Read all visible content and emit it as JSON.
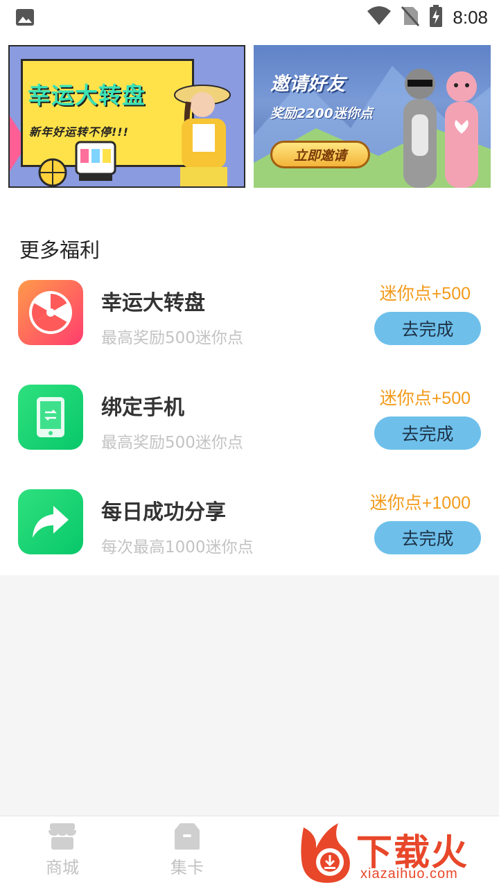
{
  "status_bar": {
    "time": "8:08",
    "icons": [
      "image-icon",
      "wifi-icon",
      "no-sim-icon",
      "battery-charging-icon"
    ]
  },
  "banners": [
    {
      "title": "幸运大转盘",
      "subtitle": "新年好运转不停!!!",
      "colors": {
        "bg": "#8b9be0",
        "panel": "#ffe24a",
        "title": "#3be2b6"
      }
    },
    {
      "title": "邀请好友",
      "subtitle": "奖励2200迷你点",
      "button_label": "立即邀请",
      "colors": {
        "bg": "#5f83c8",
        "button": "#f3b43a"
      }
    }
  ],
  "section_title": "更多福利",
  "tasks": [
    {
      "name": "幸运大转盘",
      "desc": "最高奖励500迷你点",
      "reward": "迷你点+500",
      "button_label": "去完成",
      "icon": "lucky-wheel-icon",
      "icon_colors": [
        "#ff9a4a",
        "#ff3d6e"
      ]
    },
    {
      "name": "绑定手机",
      "desc": "最高奖励500迷你点",
      "reward": "迷你点+500",
      "button_label": "去完成",
      "icon": "phone-bind-icon",
      "icon_colors": [
        "#2fe07e",
        "#08c86a"
      ]
    },
    {
      "name": "每日成功分享",
      "desc": "每次最高1000迷你点",
      "reward": "迷你点+1000",
      "button_label": "去完成",
      "icon": "share-icon",
      "icon_colors": [
        "#2fe07e",
        "#08c86a"
      ]
    }
  ],
  "bottom_nav": [
    {
      "label": "商城",
      "icon": "store-icon"
    },
    {
      "label": "集卡",
      "icon": "card-box-icon"
    }
  ],
  "watermark": {
    "text": "下载火",
    "url": "xiazaihuo.com"
  },
  "colors": {
    "reward": "#f39a1a",
    "button": "#6ec0eb",
    "page_bg": "#f6f5f6"
  }
}
